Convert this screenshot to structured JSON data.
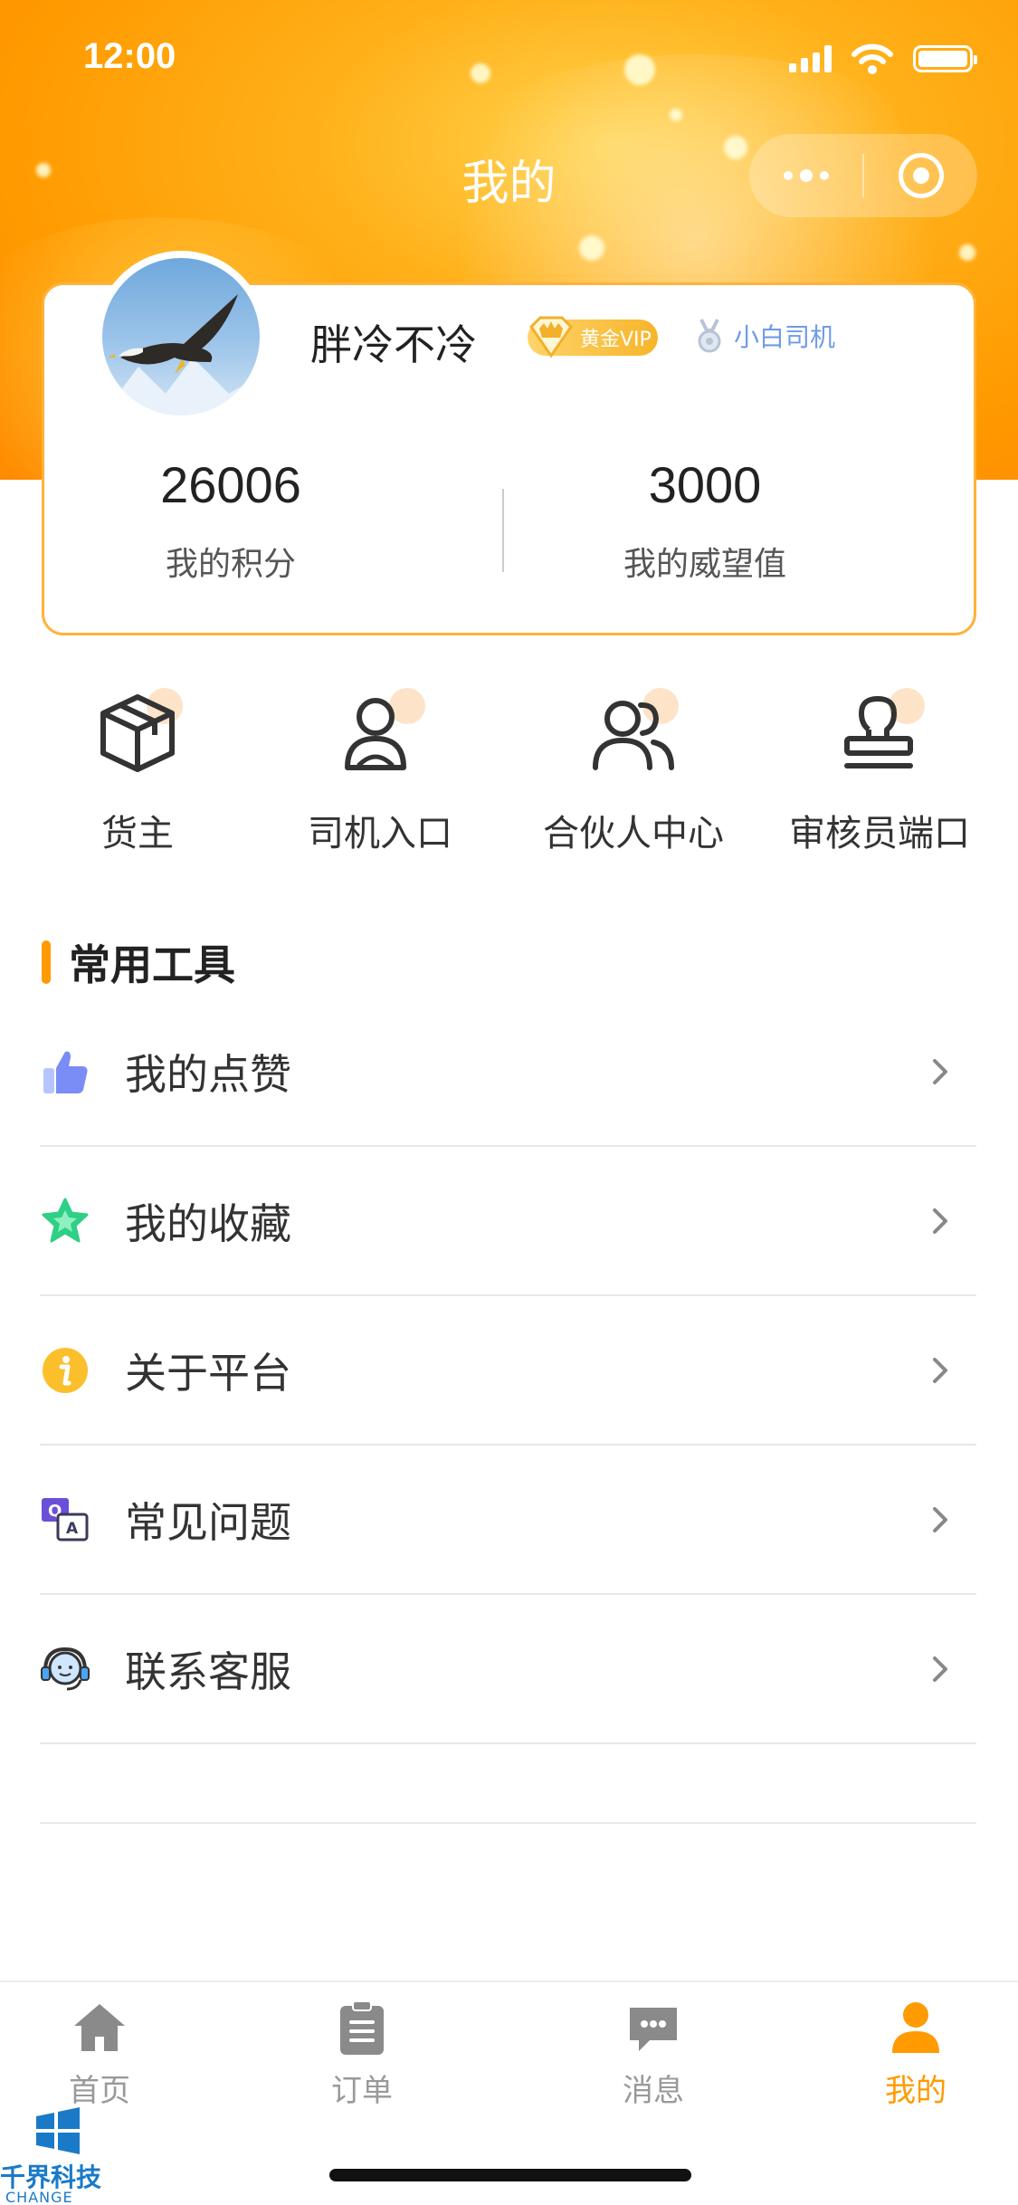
{
  "status_bar": {
    "time": "12:00"
  },
  "nav": {
    "title": "我的"
  },
  "profile": {
    "username": "胖冷不冷",
    "vip_label": "黄金VIP",
    "driver_label": "小白司机",
    "stats": [
      {
        "value": "26006",
        "label": "我的积分"
      },
      {
        "value": "3000",
        "label": "我的威望值"
      }
    ]
  },
  "entries": [
    {
      "label": "货主",
      "icon": "box-icon"
    },
    {
      "label": "司机入口",
      "icon": "driver-icon"
    },
    {
      "label": "合伙人中心",
      "icon": "partners-icon"
    },
    {
      "label": "审核员端口",
      "icon": "stamp-icon"
    }
  ],
  "tools": {
    "title": "常用工具",
    "items": [
      {
        "label": "我的点赞",
        "icon": "thumbs-up-icon"
      },
      {
        "label": "我的收藏",
        "icon": "star-icon"
      },
      {
        "label": "关于平台",
        "icon": "info-icon"
      },
      {
        "label": "常见问题",
        "icon": "qa-icon"
      },
      {
        "label": "联系客服",
        "icon": "headset-icon"
      }
    ]
  },
  "tabbar": {
    "items": [
      {
        "label": "首页",
        "icon": "home-icon"
      },
      {
        "label": "订单",
        "icon": "clipboard-icon"
      },
      {
        "label": "消息",
        "icon": "message-icon"
      },
      {
        "label": "我的",
        "icon": "person-icon",
        "active": true
      }
    ]
  },
  "watermark": {
    "text": "千界科技",
    "sub": "CHANGE"
  },
  "colors": {
    "accent": "#ff9a00",
    "card_border": "#ffb23c",
    "driver_badge": "#6e9be6"
  }
}
